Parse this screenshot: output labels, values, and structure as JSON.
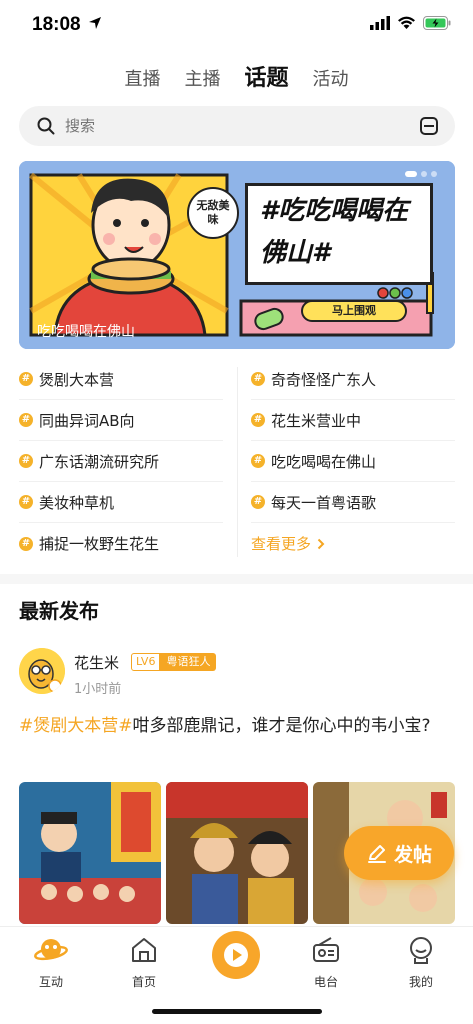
{
  "status_bar": {
    "time": "18:08"
  },
  "top_tabs": [
    {
      "label": "直播",
      "active": false
    },
    {
      "label": "主播",
      "active": false
    },
    {
      "label": "话题",
      "active": true
    },
    {
      "label": "活动",
      "active": false
    }
  ],
  "search": {
    "placeholder": "搜索"
  },
  "banner": {
    "caption": "吃吃喝喝在佛山",
    "bubble": "无敌美味",
    "title": "#吃吃喝喝在佛山#",
    "button": "马上围观"
  },
  "topics": {
    "left": [
      "煲剧大本营",
      "同曲异词AB向",
      "广东话潮流研究所",
      "美妆种草机",
      "捕捉一枚野生花生"
    ],
    "right": [
      "奇奇怪怪广东人",
      "花生米营业中",
      "吃吃喝喝在佛山",
      "每天一首粤语歌"
    ],
    "see_more": "查看更多"
  },
  "section": {
    "title": "最新发布"
  },
  "post": {
    "username": "花生米",
    "level": "LV6",
    "level_title": "粤语狂人",
    "time": "1小时前",
    "tag": "#煲剧大本营#",
    "text": "咁多部鹿鼎记，谁才是你心中的韦小宝?"
  },
  "fab": {
    "label": "发帖"
  },
  "tabbar": [
    {
      "label": "互动"
    },
    {
      "label": "首页"
    },
    {
      "label": ""
    },
    {
      "label": "电台"
    },
    {
      "label": "我的"
    }
  ],
  "colors": {
    "accent": "#f5a623",
    "fab": "#f8a62a"
  }
}
